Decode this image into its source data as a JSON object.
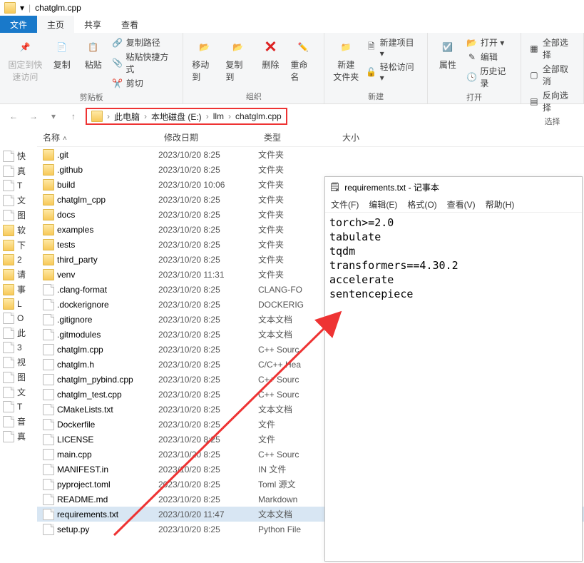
{
  "titlebar": {
    "title": "chatglm.cpp"
  },
  "tabs": {
    "file": "文件",
    "home": "主页",
    "share": "共享",
    "view": "查看"
  },
  "ribbon": {
    "pin": "固定到快\n速访问",
    "copy": "复制",
    "paste": "粘贴",
    "clip_path": "复制路径",
    "paste_shortcut": "粘贴快捷方式",
    "cut": "剪切",
    "clipboard_group": "剪贴板",
    "move": "移动到",
    "copyto": "复制到",
    "delete": "删除",
    "rename": "重命名",
    "organize_group": "组织",
    "new_folder": "新建\n文件夹",
    "new_item": "新建项目 ▾",
    "easy_access": "轻松访问 ▾",
    "new_group": "新建",
    "properties": "属性",
    "open_btn": "打开 ▾",
    "edit": "编辑",
    "history": "历史记录",
    "open_group": "打开",
    "select_all": "全部选择",
    "select_none": "全部取消",
    "invert": "反向选择",
    "select_group": "选择"
  },
  "breadcrumb": {
    "pc": "此电脑",
    "drive": "本地磁盘 (E:)",
    "dir1": "llm",
    "dir2": "chatglm.cpp"
  },
  "headers": {
    "name": "名称",
    "date": "修改日期",
    "type": "类型",
    "size": "大小"
  },
  "sidebar": [
    {
      "icon": "star",
      "label": "快"
    },
    {
      "icon": "desktop",
      "label": "真"
    },
    {
      "icon": "download",
      "label": "T"
    },
    {
      "icon": "doc",
      "label": "文"
    },
    {
      "icon": "pic",
      "label": "图"
    },
    {
      "icon": "folder",
      "label": "软"
    },
    {
      "icon": "folder",
      "label": "下"
    },
    {
      "icon": "folder",
      "label": "2"
    },
    {
      "icon": "folder",
      "label": "请"
    },
    {
      "icon": "folder",
      "label": "事"
    },
    {
      "icon": "folder",
      "label": "L"
    },
    {
      "icon": "onedrive",
      "label": "O"
    },
    {
      "icon": "pc",
      "label": "此"
    },
    {
      "icon": "obj",
      "label": "3"
    },
    {
      "icon": "video",
      "label": "视"
    },
    {
      "icon": "pic",
      "label": "图"
    },
    {
      "icon": "doc",
      "label": "文"
    },
    {
      "icon": "download",
      "label": "T"
    },
    {
      "icon": "music",
      "label": "音"
    },
    {
      "icon": "desktop",
      "label": "真"
    }
  ],
  "files": [
    {
      "icon": "folder",
      "name": ".git",
      "date": "2023/10/20 8:25",
      "type": "文件夹"
    },
    {
      "icon": "folder",
      "name": ".github",
      "date": "2023/10/20 8:25",
      "type": "文件夹"
    },
    {
      "icon": "folder",
      "name": "build",
      "date": "2023/10/20 10:06",
      "type": "文件夹"
    },
    {
      "icon": "folder",
      "name": "chatglm_cpp",
      "date": "2023/10/20 8:25",
      "type": "文件夹"
    },
    {
      "icon": "folder",
      "name": "docs",
      "date": "2023/10/20 8:25",
      "type": "文件夹"
    },
    {
      "icon": "folder",
      "name": "examples",
      "date": "2023/10/20 8:25",
      "type": "文件夹"
    },
    {
      "icon": "folder",
      "name": "tests",
      "date": "2023/10/20 8:25",
      "type": "文件夹"
    },
    {
      "icon": "folder",
      "name": "third_party",
      "date": "2023/10/20 8:25",
      "type": "文件夹"
    },
    {
      "icon": "folder",
      "name": "venv",
      "date": "2023/10/20 11:31",
      "type": "文件夹"
    },
    {
      "icon": "file",
      "name": ".clang-format",
      "date": "2023/10/20 8:25",
      "type": "CLANG-FO"
    },
    {
      "icon": "file",
      "name": ".dockerignore",
      "date": "2023/10/20 8:25",
      "type": "DOCKERIG"
    },
    {
      "icon": "file",
      "name": ".gitignore",
      "date": "2023/10/20 8:25",
      "type": "文本文档"
    },
    {
      "icon": "file",
      "name": ".gitmodules",
      "date": "2023/10/20 8:25",
      "type": "文本文档"
    },
    {
      "icon": "cpp",
      "name": "chatglm.cpp",
      "date": "2023/10/20 8:25",
      "type": "C++ Sourc"
    },
    {
      "icon": "h",
      "name": "chatglm.h",
      "date": "2023/10/20 8:25",
      "type": "C/C++ Hea"
    },
    {
      "icon": "cpp",
      "name": "chatglm_pybind.cpp",
      "date": "2023/10/20 8:25",
      "type": "C++ Sourc"
    },
    {
      "icon": "cpp",
      "name": "chatglm_test.cpp",
      "date": "2023/10/20 8:25",
      "type": "C++ Sourc"
    },
    {
      "icon": "file",
      "name": "CMakeLists.txt",
      "date": "2023/10/20 8:25",
      "type": "文本文档"
    },
    {
      "icon": "file",
      "name": "Dockerfile",
      "date": "2023/10/20 8:25",
      "type": "文件"
    },
    {
      "icon": "file",
      "name": "LICENSE",
      "date": "2023/10/20 8:25",
      "type": "文件"
    },
    {
      "icon": "cpp",
      "name": "main.cpp",
      "date": "2023/10/20 8:25",
      "type": "C++ Sourc"
    },
    {
      "icon": "file",
      "name": "MANIFEST.in",
      "date": "2023/10/20 8:25",
      "type": "IN 文件"
    },
    {
      "icon": "file",
      "name": "pyproject.toml",
      "date": "2023/10/20 8:25",
      "type": "Toml 源文"
    },
    {
      "icon": "file",
      "name": "README.md",
      "date": "2023/10/20 8:25",
      "type": "Markdown"
    },
    {
      "icon": "file",
      "name": "requirements.txt",
      "date": "2023/10/20 11:47",
      "type": "文本文档",
      "selected": true
    },
    {
      "icon": "file",
      "name": "setup.py",
      "date": "2023/10/20 8:25",
      "type": "Python File"
    }
  ],
  "notepad": {
    "title": "requirements.txt - 记事本",
    "menu": {
      "file": "文件(F)",
      "edit": "编辑(E)",
      "format": "格式(O)",
      "view": "查看(V)",
      "help": "帮助(H)"
    },
    "body": "torch>=2.0\ntabulate\ntqdm\ntransformers==4.30.2\naccelerate\nsentencepiece"
  }
}
